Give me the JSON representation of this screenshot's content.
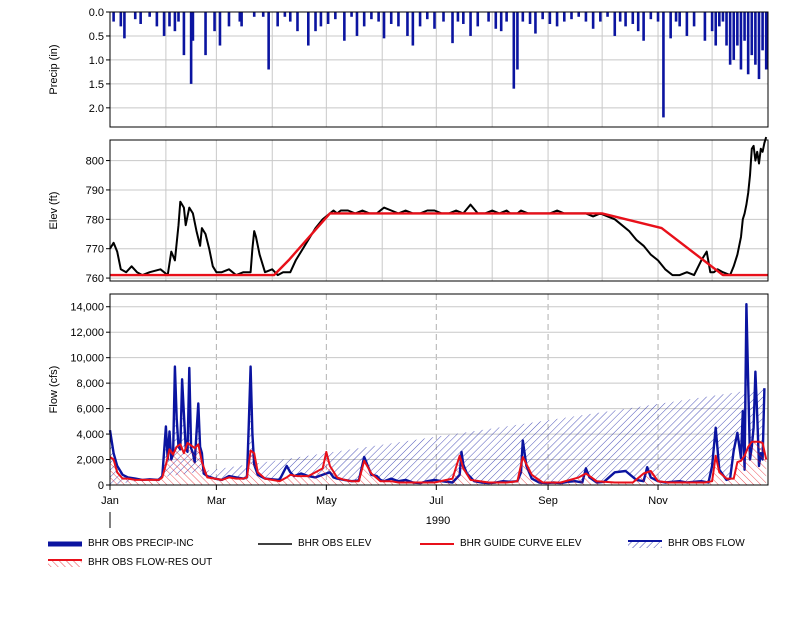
{
  "chart_data": [
    {
      "type": "bar",
      "ylabel": "Precip (in)",
      "ylim": [
        0,
        2.4
      ],
      "inverted": true,
      "yticks": [
        "0.0",
        "0.5",
        "1.0",
        "1.5",
        "2.0"
      ],
      "series": [
        {
          "name": "BHR OBS PRECIP-INC",
          "color": "#0b14a0",
          "x_day": [
            2,
            6,
            8,
            14,
            17,
            22,
            26,
            30,
            33,
            36,
            38,
            41,
            45,
            46,
            53,
            58,
            61,
            66,
            72,
            73,
            80,
            85,
            88,
            93,
            97,
            100,
            104,
            110,
            114,
            117,
            121,
            125,
            130,
            134,
            137,
            141,
            145,
            149,
            152,
            156,
            160,
            165,
            168,
            172,
            176,
            180,
            185,
            190,
            193,
            196,
            200,
            204,
            210,
            214,
            217,
            220,
            224,
            226,
            229,
            233,
            236,
            240,
            244,
            248,
            252,
            256,
            260,
            264,
            268,
            272,
            276,
            280,
            283,
            286,
            290,
            293,
            296,
            300,
            304,
            307,
            311,
            314,
            316,
            320,
            324,
            330,
            334,
            336,
            338,
            340,
            342,
            344,
            346,
            348,
            350,
            352,
            354,
            356,
            358,
            360,
            362,
            364
          ],
          "values": [
            0.2,
            0.3,
            0.55,
            0.15,
            0.25,
            0.1,
            0.3,
            0.5,
            0.3,
            0.4,
            0.2,
            0.9,
            1.5,
            0.6,
            0.9,
            0.4,
            0.7,
            0.3,
            0.2,
            0.3,
            0.1,
            0.1,
            1.2,
            0.3,
            0.1,
            0.2,
            0.4,
            0.7,
            0.4,
            0.3,
            0.25,
            0.15,
            0.6,
            0.1,
            0.5,
            0.3,
            0.15,
            0.2,
            0.55,
            0.25,
            0.3,
            0.5,
            0.7,
            0.3,
            0.15,
            0.35,
            0.2,
            0.65,
            0.2,
            0.25,
            0.5,
            0.3,
            0.2,
            0.35,
            0.4,
            0.2,
            1.6,
            1.2,
            0.2,
            0.25,
            0.45,
            0.15,
            0.25,
            0.3,
            0.2,
            0.15,
            0.1,
            0.2,
            0.35,
            0.2,
            0.1,
            0.5,
            0.2,
            0.3,
            0.25,
            0.4,
            0.6,
            0.15,
            0.2,
            2.2,
            0.55,
            0.2,
            0.3,
            0.5,
            0.3,
            0.6,
            0.4,
            0.7,
            0.3,
            0.2,
            0.7,
            1.1,
            1.0,
            0.7,
            1.2,
            0.6,
            1.3,
            0.9,
            1.1,
            1.4,
            0.8,
            1.2,
            0.9,
            1.35
          ]
        }
      ]
    },
    {
      "type": "line",
      "ylabel": "Elev (ft)",
      "ylim": [
        759,
        807
      ],
      "yticks": [
        "760",
        "770",
        "780",
        "790",
        "800"
      ],
      "series": [
        {
          "name": "BHR OBS ELEV",
          "color": "#000000",
          "x_day": [
            0,
            2,
            4,
            6,
            9,
            12,
            15,
            18,
            22,
            28,
            32,
            34,
            36,
            38,
            39,
            41,
            42,
            44,
            46,
            48,
            50,
            51,
            53,
            55,
            57,
            59,
            62,
            66,
            70,
            74,
            78,
            79,
            80,
            81,
            83,
            86,
            90,
            93,
            96,
            100,
            103,
            106,
            110,
            114,
            118,
            122,
            124,
            126,
            128,
            132,
            136,
            140,
            144,
            148,
            152,
            156,
            160,
            164,
            168,
            172,
            176,
            180,
            184,
            188,
            192,
            196,
            200,
            204,
            208,
            212,
            216,
            220,
            222,
            224,
            226,
            228,
            232,
            236,
            240,
            244,
            248,
            252,
            256,
            260,
            264,
            268,
            272,
            276,
            280,
            284,
            288,
            292,
            296,
            300,
            304,
            308,
            312,
            316,
            320,
            324,
            328,
            331,
            333,
            335,
            337,
            340,
            344,
            346,
            348,
            350,
            351,
            352,
            353,
            354,
            355,
            356,
            357,
            358,
            359,
            360,
            361,
            362,
            363,
            364
          ],
          "values": [
            770,
            772,
            769,
            763,
            762,
            764,
            762,
            761,
            762,
            763,
            761,
            769,
            766,
            778,
            786,
            784,
            778,
            784,
            782,
            776,
            771,
            777,
            775,
            770,
            764,
            762,
            762,
            763,
            761,
            762,
            762,
            770,
            776,
            774,
            768,
            762,
            763,
            761,
            762,
            762,
            766,
            769,
            773,
            777,
            780,
            782,
            783,
            782,
            783,
            783,
            782,
            783,
            782,
            782,
            784,
            783,
            782,
            783,
            782,
            782,
            783,
            783,
            782,
            782,
            783,
            782,
            785,
            782,
            782,
            783,
            782,
            783,
            782,
            782,
            782,
            783,
            782,
            782,
            782,
            782,
            783,
            782,
            782,
            782,
            782,
            781,
            782,
            781,
            780,
            778,
            776,
            773,
            771,
            768,
            766,
            763,
            761,
            761,
            762,
            761,
            766,
            769,
            762,
            762,
            763,
            762,
            761,
            764,
            768,
            774,
            780,
            782,
            785,
            789,
            795,
            804,
            805,
            800,
            803,
            799,
            804,
            803,
            806,
            808
          ]
        },
        {
          "name": "BHR GUIDE CURVE ELEV",
          "color": "#e8101a",
          "x_day": [
            0,
            91,
            99,
            122,
            273,
            306,
            340,
            365
          ],
          "values": [
            761,
            761,
            766,
            782,
            782,
            777,
            761,
            761
          ]
        }
      ]
    },
    {
      "type": "line",
      "ylabel": "Flow (cfs)",
      "ylim": [
        0,
        15000
      ],
      "yticks": [
        "0",
        "2,000",
        "4,000",
        "6,000",
        "8,000",
        "10,000",
        "12,000",
        "14,000"
      ],
      "xticks": [
        "Jan",
        "Mar",
        "May",
        "Jul",
        "Sep",
        "Nov"
      ],
      "xticks_day": [
        0,
        59,
        120,
        181,
        243,
        304
      ],
      "xlabel": "1990",
      "series": [
        {
          "name": "BHR OBS FLOW",
          "color": "#0b14a0",
          "x_day": [
            0,
            2,
            4,
            7,
            10,
            14,
            18,
            22,
            27,
            29,
            31,
            32,
            33,
            34,
            35,
            36,
            37,
            38,
            39,
            40,
            42,
            43,
            44,
            45,
            46,
            47,
            49,
            50,
            51,
            52,
            54,
            56,
            58,
            62,
            66,
            70,
            74,
            76,
            77,
            78,
            79,
            80,
            82,
            86,
            90,
            94,
            98,
            100,
            102,
            106,
            110,
            114,
            118,
            120,
            122,
            124,
            126,
            130,
            134,
            138,
            141,
            143,
            145,
            148,
            150,
            152,
            156,
            160,
            164,
            168,
            172,
            176,
            180,
            184,
            190,
            194,
            195,
            196,
            198,
            202,
            206,
            210,
            214,
            218,
            222,
            226,
            228,
            229,
            231,
            234,
            238,
            242,
            246,
            250,
            254,
            258,
            262,
            264,
            266,
            270,
            274,
            280,
            286,
            292,
            296,
            298,
            300,
            304,
            308,
            312,
            316,
            320,
            324,
            328,
            332,
            334,
            336,
            338,
            340,
            342,
            344,
            346,
            348,
            350,
            351,
            352,
            353,
            354,
            355,
            356,
            357,
            358,
            359,
            360,
            361,
            362,
            363,
            364
          ],
          "values": [
            4300,
            2500,
            1500,
            800,
            600,
            500,
            400,
            450,
            400,
            700,
            4600,
            2000,
            4200,
            2000,
            2400,
            9300,
            5200,
            3000,
            2800,
            8300,
            2900,
            2600,
            9200,
            2900,
            2500,
            1800,
            6400,
            3000,
            2500,
            900,
            700,
            600,
            500,
            400,
            700,
            600,
            500,
            600,
            4800,
            9300,
            4000,
            1600,
            800,
            500,
            450,
            400,
            1500,
            1000,
            700,
            900,
            700,
            600,
            800,
            900,
            1000,
            600,
            500,
            400,
            300,
            350,
            2200,
            1500,
            800,
            700,
            400,
            300,
            500,
            300,
            400,
            200,
            150,
            300,
            400,
            300,
            200,
            800,
            2600,
            1600,
            900,
            300,
            200,
            150,
            200,
            300,
            250,
            300,
            1000,
            3500,
            1500,
            500,
            200,
            150,
            200,
            150,
            250,
            300,
            200,
            1300,
            600,
            200,
            250,
            1000,
            1100,
            400,
            300,
            1400,
            600,
            300,
            200,
            250,
            300,
            200,
            250,
            300,
            200,
            1500,
            4500,
            1200,
            800,
            400,
            500,
            2700,
            4100,
            2100,
            5800,
            1200,
            14200,
            8000,
            2000,
            3000,
            4500,
            8900,
            5500,
            1500,
            2500,
            2000,
            7600
          ]
        },
        {
          "name": "BHR OBS FLOW-RES OUT",
          "color": "#e8101a",
          "x_day": [
            0,
            2,
            4,
            7,
            10,
            14,
            18,
            22,
            27,
            29,
            31,
            33,
            35,
            37,
            39,
            41,
            43,
            45,
            47,
            49,
            51,
            54,
            58,
            62,
            66,
            70,
            74,
            76,
            78,
            80,
            82,
            86,
            90,
            94,
            98,
            100,
            104,
            110,
            114,
            118,
            120,
            122,
            126,
            130,
            134,
            138,
            141,
            145,
            150,
            156,
            160,
            170,
            180,
            190,
            194,
            196,
            200,
            210,
            220,
            226,
            229,
            234,
            240,
            250,
            260,
            264,
            270,
            280,
            290,
            296,
            300,
            304,
            310,
            320,
            330,
            334,
            336,
            338,
            342,
            346,
            348,
            350,
            352,
            354,
            356,
            358,
            360,
            362,
            364
          ],
          "values": [
            2200,
            2000,
            1000,
            500,
            500,
            400,
            400,
            400,
            400,
            600,
            1600,
            2800,
            2400,
            3000,
            3200,
            2500,
            3300,
            3100,
            2900,
            3200,
            1800,
            600,
            500,
            400,
            600,
            500,
            500,
            600,
            2700,
            2500,
            1000,
            500,
            400,
            300,
            600,
            800,
            700,
            700,
            1000,
            1300,
            2600,
            1500,
            600,
            400,
            300,
            300,
            1900,
            900,
            300,
            300,
            200,
            200,
            200,
            500,
            2300,
            1300,
            400,
            200,
            200,
            300,
            2200,
            800,
            200,
            200,
            600,
            900,
            300,
            200,
            200,
            900,
            1100,
            300,
            200,
            200,
            200,
            300,
            2300,
            1000,
            500,
            500,
            1800,
            1900,
            2300,
            3000,
            3400,
            3400,
            3400,
            3300,
            2000
          ]
        }
      ]
    }
  ],
  "legend": [
    {
      "label": "BHR OBS PRECIP-INC",
      "style": "thick",
      "color": "#0b14a0"
    },
    {
      "label": "BHR OBS ELEV",
      "style": "line",
      "color": "#000000"
    },
    {
      "label": "BHR GUIDE CURVE ELEV",
      "style": "line",
      "color": "#e8101a"
    },
    {
      "label": "BHR OBS FLOW",
      "style": "hatch",
      "color": "#0b14a0"
    },
    {
      "label": "BHR OBS FLOW-RES OUT",
      "style": "hatch",
      "color": "#e8101a"
    }
  ]
}
